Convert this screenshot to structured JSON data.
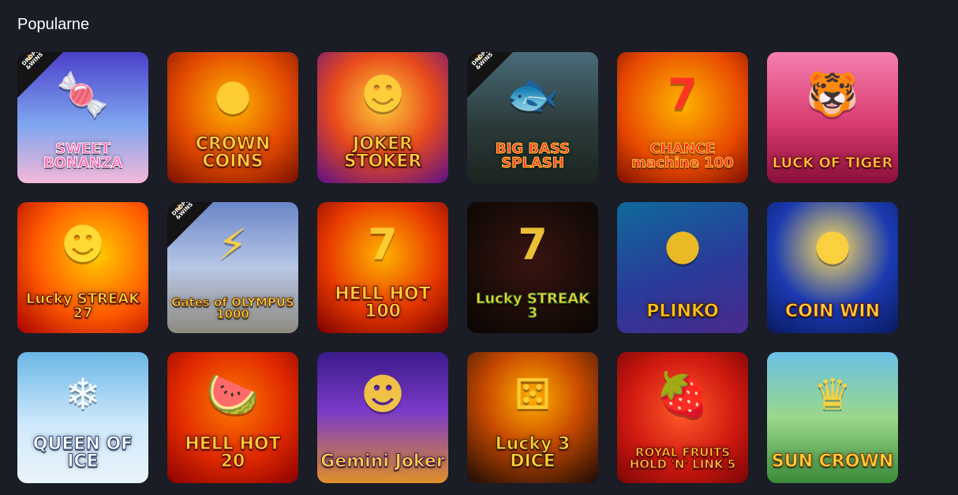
{
  "section": {
    "title": "Popularne"
  },
  "badge": {
    "line1": "DROPS",
    "line2": "&WINS"
  },
  "games": [
    {
      "title": "SWEET BONANZA",
      "badge": true,
      "icon": "candy-icon",
      "bg": "linear-gradient(180deg,#4b3fc9 0%,#7fa6f0 55%,#f5b8d8 100%)",
      "color": "#ff5fb4",
      "outline": "#ffffff"
    },
    {
      "title": "CROWN COINS",
      "badge": false,
      "icon": "coin-icon",
      "bg": "radial-gradient(circle at 50% 40%,#ffb400 0%,#e24a00 55%,#7a0e00 100%)",
      "color": "#ffd23a",
      "outline": "#7a1400"
    },
    {
      "title": "JOKER STOKER",
      "badge": false,
      "icon": "jester-icon",
      "bg": "radial-gradient(circle at 50% 40%,#ffcc3a 0%,#e84a1b 50%,#5c0f8a 100%)",
      "color": "#ffd23a",
      "outline": "#5a0000"
    },
    {
      "title": "BIG BASS SPLASH",
      "badge": true,
      "icon": "fish-icon",
      "bg": "linear-gradient(180deg,#4a6b7a 0%,#2b3b3a 55%,#1b2420 100%)",
      "color": "#ff3b2e",
      "outline": "#ffd23a"
    },
    {
      "title": "CHANCE machine 100",
      "badge": false,
      "icon": "seven-icon",
      "bg": "radial-gradient(circle at 50% 40%,#ffb400 0%,#e84a00 60%,#7a0d00 100%)",
      "color": "#ff2a2a",
      "outline": "#ffd23a"
    },
    {
      "title": "LUCK OF TIGER",
      "badge": false,
      "icon": "tiger-icon",
      "bg": "linear-gradient(180deg,#f57fb0 0%,#d93a6e 55%,#8a0f3a 100%)",
      "color": "#ffd23a",
      "outline": "#8a0f1a"
    },
    {
      "title": "Lucky STREAK 27",
      "badge": false,
      "icon": "jester-icon",
      "bg": "radial-gradient(circle at 60% 40%,#ffcc00 0%,#ff5a00 55%,#a80000 100%)",
      "color": "#ffe03a",
      "outline": "#6a0000"
    },
    {
      "title": "Gates of OLYMPUS 1000",
      "badge": true,
      "icon": "zeus-icon",
      "bg": "linear-gradient(180deg,#6a86c8 0%,#b8c7e6 50%,#8e8a80 100%)",
      "color": "#ffd23a",
      "outline": "#6a3a10"
    },
    {
      "title": "HELL HOT 100",
      "badge": false,
      "icon": "seven-icon",
      "bg": "radial-gradient(circle at 50% 40%,#ffb400 0%,#e83a00 55%,#7a0000 100%)",
      "color": "#ffd23a",
      "outline": "#7a0000"
    },
    {
      "title": "Lucky STREAK 3",
      "badge": false,
      "icon": "seven-icon",
      "bg": "radial-gradient(circle at 50% 45%,#3a1410 0%,#1a0c08 60%,#0a0503 100%)",
      "color": "#ffd23a",
      "outline": "#2a6a1a"
    },
    {
      "title": "PLINKO",
      "badge": false,
      "icon": "ball-icon",
      "bg": "linear-gradient(160deg,#0f6a9a 0%,#2a3a9a 55%,#4a2a8a 100%)",
      "color": "#ffc61a",
      "outline": "#5a2a00"
    },
    {
      "title": "COIN WIN",
      "badge": false,
      "icon": "coin-icon",
      "bg": "radial-gradient(circle at 50% 35%,#ffe060 0%,#1a3ab0 55%,#0a1a60 100%)",
      "color": "#ffd23a",
      "outline": "#7a1a00"
    },
    {
      "title": "QUEEN OF ICE",
      "badge": false,
      "icon": "queen-icon",
      "bg": "linear-gradient(180deg,#6ab6e6 0%,#cfe9fb 55%,#eaf4fb 100%)",
      "color": "#ffffff",
      "outline": "#2a4a8a"
    },
    {
      "title": "HELL HOT 20",
      "badge": false,
      "icon": "watermelon-icon",
      "bg": "radial-gradient(circle at 50% 40%,#ff7a00 0%,#e02a00 55%,#8a0000 100%)",
      "color": "#ffd23a",
      "outline": "#7a0000"
    },
    {
      "title": "Gemini Joker",
      "badge": false,
      "icon": "jester-icon",
      "bg": "linear-gradient(180deg,#3a1a8a 0%,#7a3ac8 45%,#e0902a 100%)",
      "color": "#ffd23a",
      "outline": "#4a1a6a"
    },
    {
      "title": "Lucky 3 DICE",
      "badge": false,
      "icon": "dice-icon",
      "bg": "radial-gradient(circle at 50% 35%,#ffb000 0%,#c84a00 45%,#1a0a05 100%)",
      "color": "#ffd23a",
      "outline": "#3a1a00"
    },
    {
      "title": "ROYAL FRUITS HOLD 'N' LINK 5",
      "badge": false,
      "icon": "strawberry-icon",
      "bg": "radial-gradient(circle at 50% 45%,#ff5a2a 0%,#d01a10 55%,#7a0505 100%)",
      "color": "#ffd23a",
      "outline": "#7a0000"
    },
    {
      "title": "SUN CROWN",
      "badge": false,
      "icon": "crown-icon",
      "bg": "linear-gradient(180deg,#6ac0e6 0%,#9ad88a 50%,#3a8a3a 100%)",
      "color": "#ffd23a",
      "outline": "#8a3a00"
    }
  ]
}
